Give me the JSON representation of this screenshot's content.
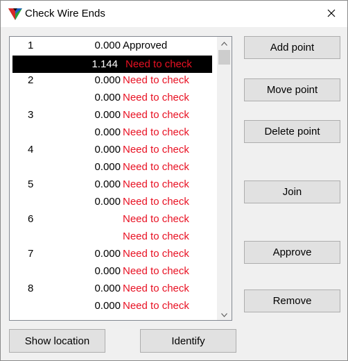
{
  "window": {
    "title": "Check Wire Ends",
    "close_label": "×"
  },
  "list": {
    "rows": [
      {
        "id": "1",
        "value": "0.000",
        "status": "Approved",
        "status_kind": "ok",
        "selected": false
      },
      {
        "id": "",
        "value": "1.144",
        "status": "Need to check",
        "status_kind": "check",
        "selected": true
      },
      {
        "id": "2",
        "value": "0.000",
        "status": "Need to check",
        "status_kind": "check",
        "selected": false
      },
      {
        "id": "",
        "value": "0.000",
        "status": "Need to check",
        "status_kind": "check",
        "selected": false
      },
      {
        "id": "3",
        "value": "0.000",
        "status": "Need to check",
        "status_kind": "check",
        "selected": false
      },
      {
        "id": "",
        "value": "0.000",
        "status": "Need to check",
        "status_kind": "check",
        "selected": false
      },
      {
        "id": "4",
        "value": "0.000",
        "status": "Need to check",
        "status_kind": "check",
        "selected": false
      },
      {
        "id": "",
        "value": "0.000",
        "status": "Need to check",
        "status_kind": "check",
        "selected": false
      },
      {
        "id": "5",
        "value": "0.000",
        "status": "Need to check",
        "status_kind": "check",
        "selected": false
      },
      {
        "id": "",
        "value": "0.000",
        "status": "Need to check",
        "status_kind": "check",
        "selected": false
      },
      {
        "id": "6",
        "value": "",
        "status": "Need to check",
        "status_kind": "check",
        "selected": false
      },
      {
        "id": "",
        "value": "",
        "status": "Need to check",
        "status_kind": "check",
        "selected": false
      },
      {
        "id": "7",
        "value": "0.000",
        "status": "Need to check",
        "status_kind": "check",
        "selected": false
      },
      {
        "id": "",
        "value": "0.000",
        "status": "Need to check",
        "status_kind": "check",
        "selected": false
      },
      {
        "id": "8",
        "value": "0.000",
        "status": "Need to check",
        "status_kind": "check",
        "selected": false
      },
      {
        "id": "",
        "value": "0.000",
        "status": "Need to check",
        "status_kind": "check",
        "selected": false
      }
    ]
  },
  "buttons": {
    "add_point": "Add point",
    "move_point": "Move point",
    "delete_point": "Delete point",
    "join": "Join",
    "approve": "Approve",
    "remove": "Remove",
    "show_location": "Show location",
    "identify": "Identify"
  },
  "colors": {
    "status_check": "#e81123",
    "status_ok": "#000000",
    "selection": "#000000"
  }
}
